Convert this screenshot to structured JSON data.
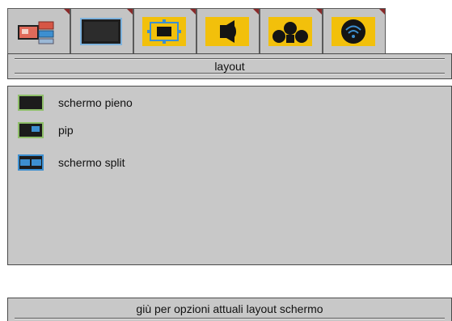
{
  "tabs": [
    {
      "icon": "media-setup-icon",
      "active": true
    },
    {
      "icon": "screen-icon",
      "active": false
    },
    {
      "icon": "layout-icon",
      "active": false
    },
    {
      "icon": "speaker-icon",
      "active": false
    },
    {
      "icon": "surround-speakers-icon",
      "active": false
    },
    {
      "icon": "wireless-icon",
      "active": false
    }
  ],
  "header": {
    "title": "layout"
  },
  "menu": {
    "items": [
      {
        "label": "schermo pieno",
        "icon": "fullscreen-layout-icon"
      },
      {
        "label": "pip",
        "icon": "pip-layout-icon"
      },
      {
        "label": "schermo split",
        "icon": "split-layout-icon"
      }
    ]
  },
  "footer": {
    "hint": "giù per opzioni attuali layout schermo"
  },
  "colors": {
    "panel": "#c8c8c8",
    "tab_accent": "#f2c00b",
    "icon_blue": "#3d8fd0",
    "icon_green": "#8fbf6a",
    "corner_marker": "#8a2a2a"
  }
}
